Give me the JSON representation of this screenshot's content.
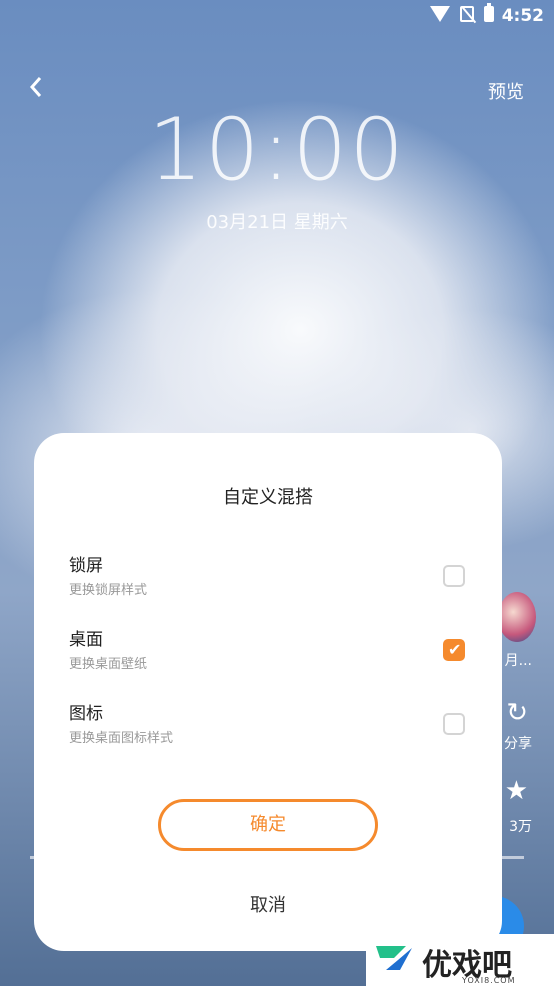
{
  "status": {
    "time": "4:52"
  },
  "header": {
    "back_icon": "chevron-left-icon",
    "preview_label": "预览"
  },
  "lockscreen": {
    "clock": "10:00",
    "date": "03月21日 星期六"
  },
  "side": {
    "avatar_label": "月...",
    "share_label": "分享",
    "star_label": "3万"
  },
  "dialog": {
    "title": "自定义混搭",
    "options": [
      {
        "name": "锁屏",
        "desc": "更换锁屏样式",
        "checked": false
      },
      {
        "name": "桌面",
        "desc": "更换桌面壁纸",
        "checked": true
      },
      {
        "name": "图标",
        "desc": "更换桌面图标样式",
        "checked": false
      }
    ],
    "confirm_label": "确定",
    "cancel_label": "取消"
  },
  "watermark": {
    "brand": "优戏吧",
    "site": "YOXI8.COM"
  },
  "colors": {
    "accent": "#f58a2d",
    "fab": "#2a8be8"
  }
}
